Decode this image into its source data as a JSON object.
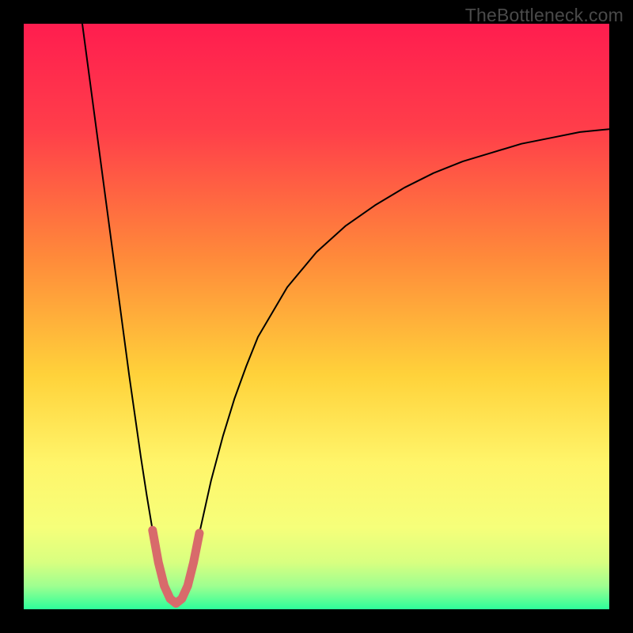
{
  "watermark": "TheBottleneck.com",
  "chart_data": {
    "type": "line",
    "title": "",
    "xlabel": "",
    "ylabel": "",
    "xlim": [
      0,
      100
    ],
    "ylim": [
      0,
      100
    ],
    "gradient_stops": [
      {
        "offset": 0.0,
        "color": "#ff1d4f"
      },
      {
        "offset": 0.18,
        "color": "#ff3e4a"
      },
      {
        "offset": 0.4,
        "color": "#ff8a3a"
      },
      {
        "offset": 0.6,
        "color": "#ffd23a"
      },
      {
        "offset": 0.75,
        "color": "#fff56a"
      },
      {
        "offset": 0.86,
        "color": "#f6ff7a"
      },
      {
        "offset": 0.92,
        "color": "#d8ff80"
      },
      {
        "offset": 0.96,
        "color": "#9fff90"
      },
      {
        "offset": 1.0,
        "color": "#2dff9a"
      }
    ],
    "series": [
      {
        "name": "curve",
        "stroke": "#000000",
        "stroke_width": 2,
        "x": [
          10.0,
          11.0,
          12.0,
          13.0,
          14.0,
          15.0,
          16.0,
          17.0,
          18.0,
          19.0,
          20.0,
          21.0,
          22.0,
          23.0,
          24.0,
          25.0,
          26.0,
          27.0,
          28.0,
          29.0,
          30.0,
          32.0,
          34.0,
          36.0,
          38.0,
          40.0,
          45.0,
          50.0,
          55.0,
          60.0,
          65.0,
          70.0,
          75.0,
          80.0,
          85.0,
          90.0,
          95.0,
          100.0
        ],
        "y": [
          100.0,
          92.5,
          85.0,
          77.5,
          70.0,
          62.5,
          55.0,
          47.5,
          40.0,
          33.0,
          26.0,
          19.5,
          13.5,
          8.0,
          4.0,
          1.8,
          1.0,
          1.8,
          4.0,
          8.0,
          13.0,
          22.0,
          29.5,
          36.0,
          41.5,
          46.5,
          55.0,
          61.0,
          65.5,
          69.0,
          72.0,
          74.5,
          76.5,
          78.0,
          79.5,
          80.5,
          81.5,
          82.0
        ]
      },
      {
        "name": "highlight",
        "stroke": "#d86a6b",
        "stroke_width": 11,
        "x": [
          22.0,
          23.0,
          24.0,
          25.0,
          26.0,
          27.0,
          28.0,
          29.0,
          30.0
        ],
        "y": [
          13.5,
          8.0,
          4.0,
          1.8,
          1.0,
          1.8,
          4.0,
          8.0,
          13.0
        ]
      }
    ]
  }
}
